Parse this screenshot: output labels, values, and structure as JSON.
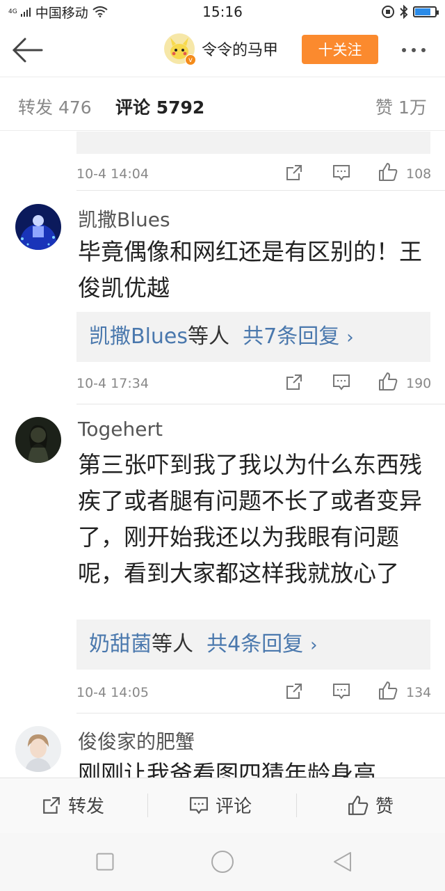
{
  "status": {
    "network_type": "4G",
    "carrier": "中国移动",
    "time": "15:16"
  },
  "header": {
    "username": "令令的马甲",
    "follow_label": "十关注",
    "verified_badge": "v"
  },
  "tabs": [
    {
      "label": "转发",
      "count": "476"
    },
    {
      "label": "评论",
      "count": "5792"
    },
    {
      "label": "赞",
      "count": "1万"
    }
  ],
  "comments": [
    {
      "name": "",
      "text": "",
      "replies": {
        "names": "",
        "mid": "",
        "count": "",
        "chevron": ""
      },
      "time": "10-4 14:04",
      "likes": "108"
    },
    {
      "name": "凯撒Blues",
      "text": "毕竟偶像和网红还是有区别的！王俊凯优越",
      "replies": {
        "names": "凯撒Blues",
        "mid": "等人",
        "count": "共7条回复",
        "chevron": "›"
      },
      "time": "10-4 17:34",
      "likes": "190"
    },
    {
      "name": "Togehert",
      "text": "第三张吓到我了我以为什么东西残疾了或者腿有问题不长了或者变异了，刚开始我还以为我眼有问题呢，看到大家都这样我就放心了",
      "replies": {
        "names": "奶甜菌",
        "mid": "等人",
        "count": "共4条回复",
        "chevron": "›"
      },
      "time": "10-4 14:05",
      "likes": "134"
    },
    {
      "name": "俊俊家的肥蟹",
      "text": "刚刚让我爸看图四猜年龄身高"
    }
  ],
  "bottom_bar": {
    "forward_label": "转发",
    "comment_label": "评论",
    "like_label": "赞"
  },
  "colors": {
    "follow_button": "#fb8a2e",
    "link_blue": "#4a78ad",
    "verified_orange": "#f48b1a"
  },
  "icons": [
    "back-arrow-icon",
    "more-dots-icon",
    "forward-icon",
    "comment-icon",
    "like-icon",
    "wifi-icon",
    "alarm-icon",
    "bluetooth-icon",
    "battery-icon"
  ]
}
